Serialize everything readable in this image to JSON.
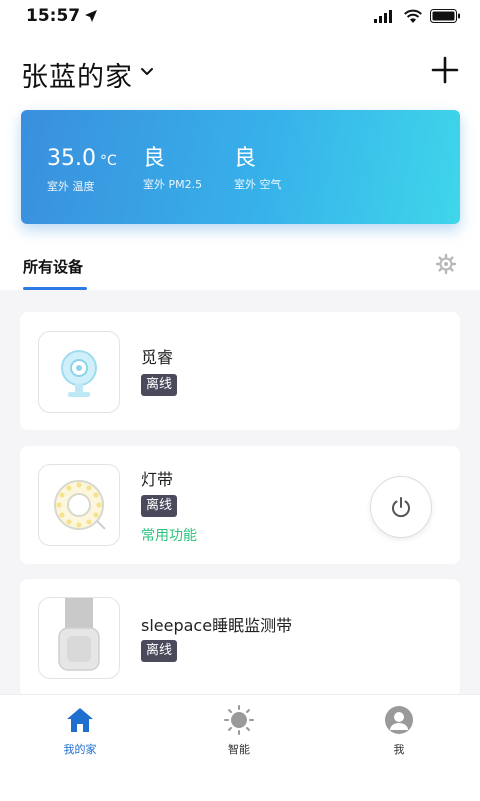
{
  "status": {
    "time": "15:57"
  },
  "header": {
    "home_name": "张蓝的家"
  },
  "weather": {
    "temperature": {
      "value": "35.0",
      "unit": "°C",
      "label": "室外 温度"
    },
    "pm25": {
      "value": "良",
      "label": "室外 PM2.5"
    },
    "air": {
      "value": "良",
      "label": "室外 空气"
    }
  },
  "tabs": {
    "all_devices": "所有设备"
  },
  "devices": [
    {
      "name": "觅睿",
      "status": "离线"
    },
    {
      "name": "灯带",
      "status": "离线",
      "function_label": "常用功能"
    },
    {
      "name": "sleepace睡眠监测带",
      "status": "离线"
    }
  ],
  "nav": {
    "home": "我的家",
    "smart": "智能",
    "me": "我"
  },
  "colors": {
    "accent": "#2c7be5",
    "function_green": "#2ec27e",
    "badge": "#4a4a5c"
  }
}
